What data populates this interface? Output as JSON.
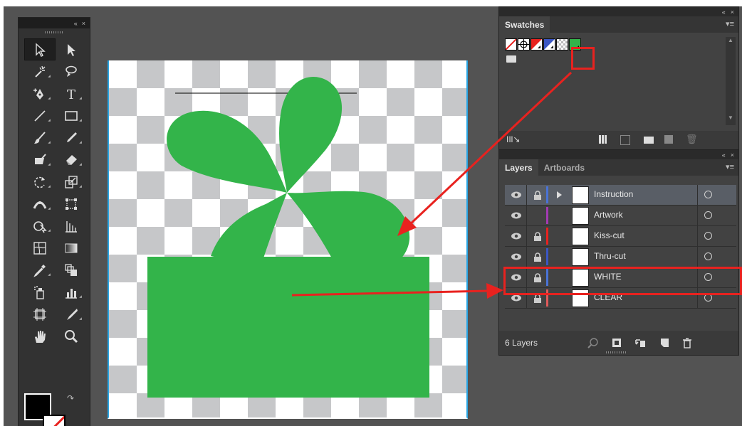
{
  "tools_panel": {
    "collapse_label": "«",
    "close_label": "×",
    "tools": [
      {
        "name": "selection-tool-icon"
      },
      {
        "name": "direct-selection-tool-icon"
      },
      {
        "name": "magic-wand-tool-icon"
      },
      {
        "name": "lasso-tool-icon"
      },
      {
        "name": "pen-tool-icon"
      },
      {
        "name": "type-tool-icon",
        "glyph": "T"
      },
      {
        "name": "line-tool-icon"
      },
      {
        "name": "rectangle-tool-icon"
      },
      {
        "name": "paintbrush-tool-icon"
      },
      {
        "name": "pencil-tool-icon"
      },
      {
        "name": "blob-brush-tool-icon"
      },
      {
        "name": "eraser-tool-icon"
      },
      {
        "name": "rotate-tool-icon"
      },
      {
        "name": "scale-tool-icon"
      },
      {
        "name": "width-tool-icon"
      },
      {
        "name": "free-transform-tool-icon"
      },
      {
        "name": "shape-builder-tool-icon"
      },
      {
        "name": "perspective-grid-tool-icon"
      },
      {
        "name": "mesh-tool-icon"
      },
      {
        "name": "gradient-tool-icon"
      },
      {
        "name": "eyedropper-tool-icon"
      },
      {
        "name": "blend-tool-icon"
      },
      {
        "name": "symbol-sprayer-tool-icon"
      },
      {
        "name": "column-graph-tool-icon"
      },
      {
        "name": "artboard-tool-icon"
      },
      {
        "name": "slice-tool-icon"
      },
      {
        "name": "hand-tool-icon"
      },
      {
        "name": "zoom-tool-icon"
      }
    ],
    "fill_color": "#000000",
    "stroke": "none"
  },
  "swatches_panel": {
    "collapse_label": "«",
    "close_label": "×",
    "tab": "Swatches",
    "menu_label": "▾≡",
    "swatches": [
      {
        "name": "none-swatch"
      },
      {
        "name": "registration-swatch"
      },
      {
        "name": "red-swatch",
        "color": "#e8221f"
      },
      {
        "name": "blue-swatch",
        "color": "#3b57c4"
      },
      {
        "name": "checker-swatch"
      },
      {
        "name": "green-swatch",
        "color": "#33b44a",
        "highlighted": true
      }
    ],
    "footer_icons": [
      "swatch-libraries-icon",
      "swatch-kind-icon",
      "swatch-options-icon",
      "new-color-group-icon",
      "new-swatch-icon",
      "delete-swatch-icon"
    ]
  },
  "layers_panel": {
    "collapse_label": "«",
    "close_label": "×",
    "tabs": [
      "Layers",
      "Artboards"
    ],
    "menu_label": "▾≡",
    "layers": [
      {
        "name": "Instruction",
        "color": "#4a73d6",
        "locked": true,
        "expandable": true,
        "selected": true
      },
      {
        "name": "Artwork",
        "color": "#a23bb3",
        "locked": false,
        "expandable": false,
        "selected": false
      },
      {
        "name": "Kiss-cut",
        "color": "#e8221f",
        "locked": true,
        "expandable": false,
        "selected": false
      },
      {
        "name": "Thru-cut",
        "color": "#3b57c4",
        "locked": true,
        "expandable": false,
        "selected": false
      },
      {
        "name": "WHITE",
        "color": "#4a73d6",
        "locked": true,
        "expandable": false,
        "selected": false,
        "highlighted": true
      },
      {
        "name": "CLEAR",
        "color": "#e05a5a",
        "locked": true,
        "expandable": false,
        "selected": false
      }
    ],
    "footer_count": "6 Layers",
    "footer_icons": [
      "locate-object-icon",
      "make-clipping-mask-icon",
      "new-sublayer-icon",
      "new-layer-icon",
      "delete-layer-icon"
    ]
  },
  "artwork": {
    "shape_color": "#33b44a",
    "annotation_color": "#e8221f"
  }
}
